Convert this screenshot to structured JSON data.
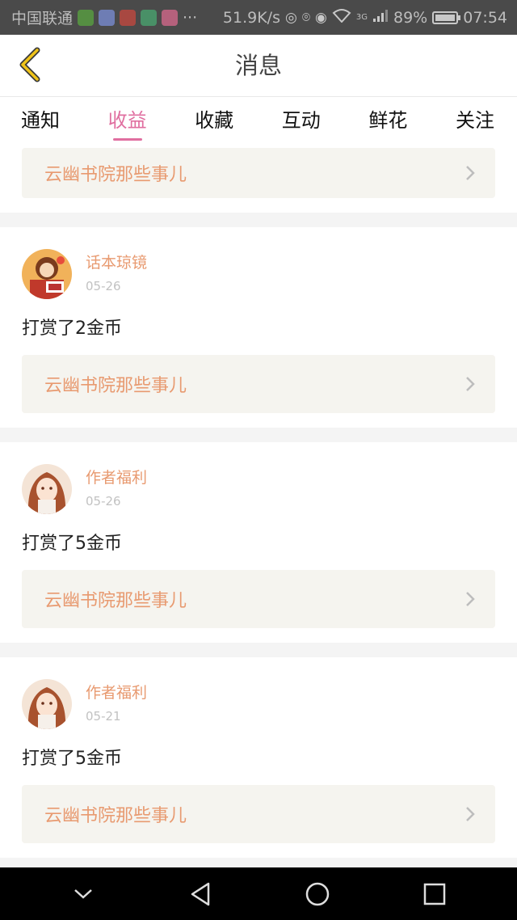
{
  "status_bar": {
    "carrier": "中国联通",
    "more": "···",
    "speed": "51.9K/s",
    "network": "3G",
    "battery": "89%",
    "time": "07:54",
    "battery_level": 0.89
  },
  "header": {
    "title": "消息",
    "back_icon": "chevron-left-icon"
  },
  "tabs": [
    {
      "label": "通知",
      "active": false
    },
    {
      "label": "收益",
      "active": true
    },
    {
      "label": "收藏",
      "active": false
    },
    {
      "label": "互动",
      "active": false
    },
    {
      "label": "鲜花",
      "active": false
    },
    {
      "label": "关注",
      "active": false
    }
  ],
  "messages": [
    {
      "book": "云幽书院那些事儿"
    },
    {
      "user": "话本琼镜",
      "date": "05-26",
      "text": "打赏了2金币",
      "book": "云幽书院那些事儿"
    },
    {
      "user": "作者福利",
      "date": "05-26",
      "text": "打赏了5金币",
      "book": "云幽书院那些事儿"
    },
    {
      "user": "作者福利",
      "date": "05-21",
      "text": "打赏了5金币",
      "book": "云幽书院那些事儿"
    }
  ],
  "colors": {
    "accent": "#e06fa0",
    "name": "#e89a70",
    "back_arrow": "#f0c419"
  }
}
